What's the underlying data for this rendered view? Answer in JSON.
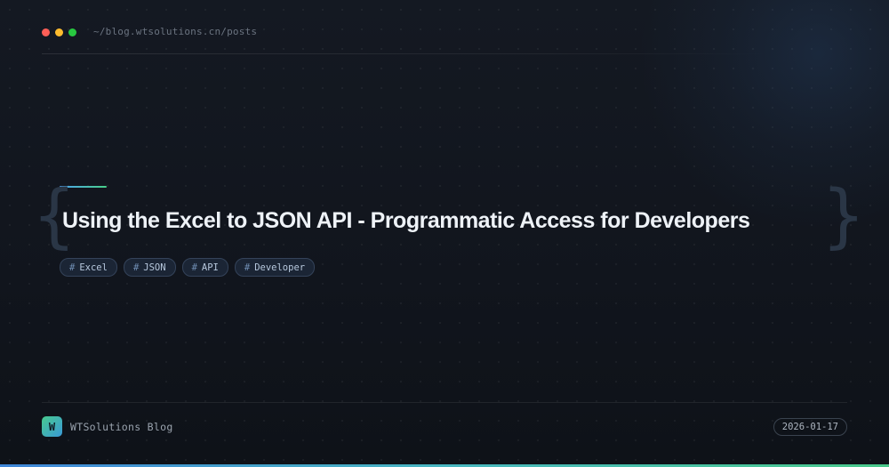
{
  "header": {
    "window_controls": [
      {
        "name": "close",
        "color": "#ff5f57"
      },
      {
        "name": "minimize",
        "color": "#febc2e"
      },
      {
        "name": "maximize",
        "color": "#28c840"
      }
    ],
    "url": "~/blog.wtsolutions.cn/posts"
  },
  "post": {
    "brace_open": "{",
    "brace_close": "}",
    "title": "Using the Excel to JSON API - Programmatic Access for Developers",
    "tag_prefix": "#",
    "tags": [
      "Excel",
      "JSON",
      "API",
      "Developer"
    ]
  },
  "footer": {
    "logo_letter": "W",
    "brand": "WTSolutions Blog",
    "date": "2026-01-17"
  },
  "colors": {
    "accent_blue": "#4ea3f0",
    "accent_green": "#48d08a",
    "background": "#11151d"
  }
}
